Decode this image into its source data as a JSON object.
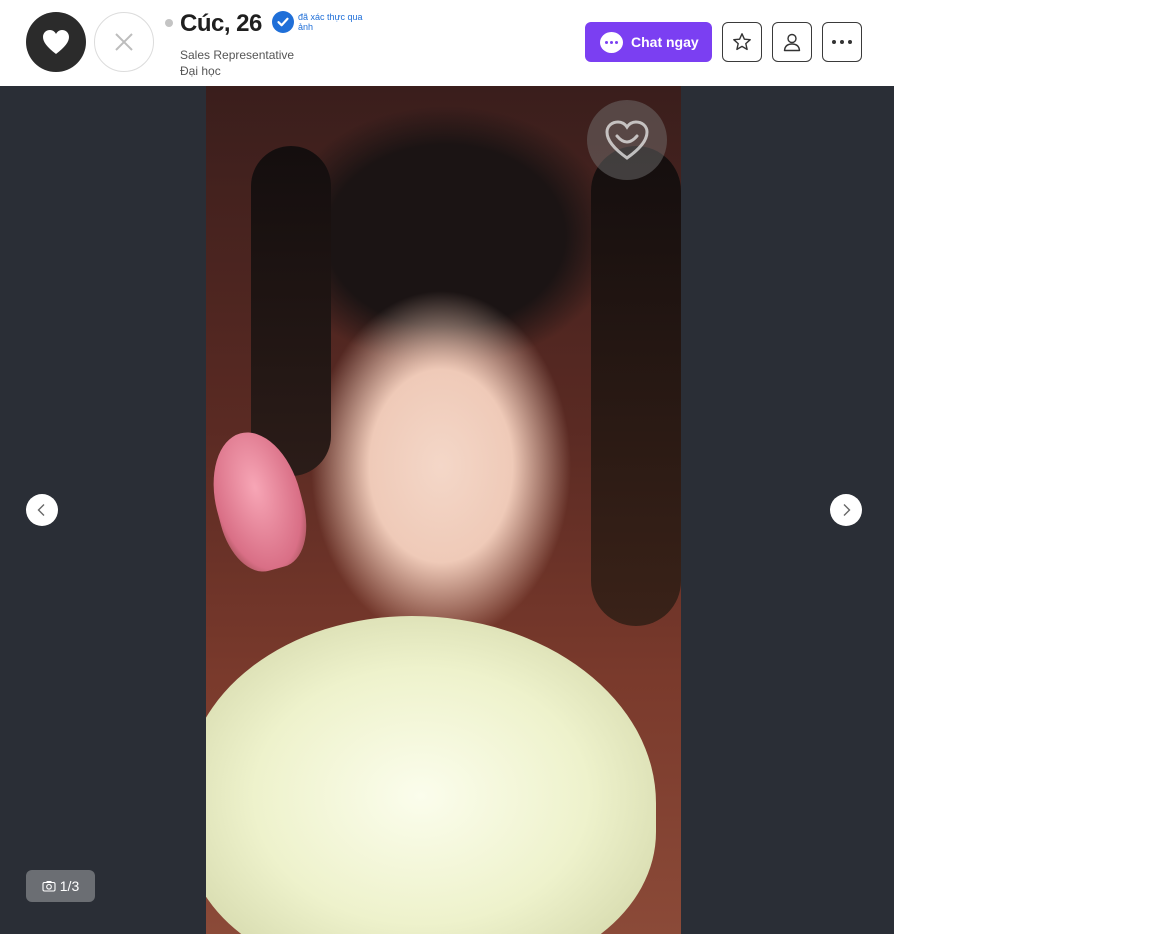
{
  "profile": {
    "name_age": "Cúc, 26",
    "verified_text": "đã xác thực qua ảnh",
    "job": "Sales Representative",
    "education": "Đại học"
  },
  "actions": {
    "chat_label": "Chat ngay"
  },
  "icons": {
    "like": "heart-icon",
    "pass": "close-icon",
    "verified": "check-badge-icon",
    "chat": "chat-bubble-icon",
    "favorite": "star-icon",
    "profile": "user-icon",
    "more": "more-dots-icon",
    "prev": "chevron-left-icon",
    "next": "chevron-right-icon",
    "photos": "camera-icon"
  },
  "gallery": {
    "counter": "1/3",
    "current": 1,
    "total": 3
  },
  "colors": {
    "accent": "#7b3ff2",
    "verified": "#1f6fd8",
    "gallery_bg": "#2a2e36"
  }
}
